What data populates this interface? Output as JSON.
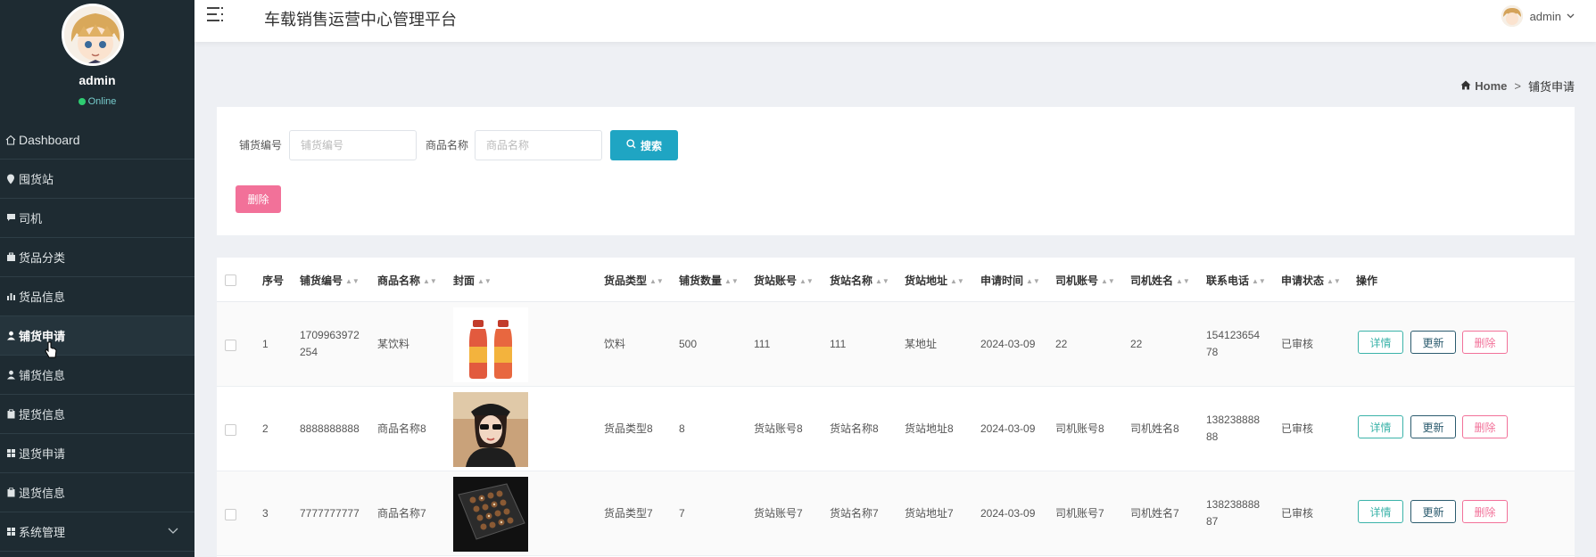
{
  "app": {
    "title": "车载销售运营中心管理平台"
  },
  "user": {
    "name": "admin",
    "status": "Online"
  },
  "top_user": {
    "name": "admin"
  },
  "sidebar": {
    "items": [
      {
        "label": "Dashboard",
        "icon": "home-icon"
      },
      {
        "label": "囤货站",
        "icon": "map-pin-icon"
      },
      {
        "label": "司机",
        "icon": "comment-icon"
      },
      {
        "label": "货品分类",
        "icon": "briefcase-icon"
      },
      {
        "label": "货品信息",
        "icon": "chart-icon"
      },
      {
        "label": "铺货申请",
        "icon": "user-icon",
        "active": true
      },
      {
        "label": "铺货信息",
        "icon": "user-icon"
      },
      {
        "label": "提货信息",
        "icon": "clipboard-icon"
      },
      {
        "label": "退货申请",
        "icon": "grid-icon"
      },
      {
        "label": "退货信息",
        "icon": "clipboard-icon"
      },
      {
        "label": "系统管理",
        "icon": "grid-icon"
      }
    ]
  },
  "breadcrumb": {
    "home": "Home",
    "separator": ">",
    "current": "铺货申请"
  },
  "search": {
    "code_label": "铺货编号",
    "code_placeholder": "铺货编号",
    "name_label": "商品名称",
    "name_placeholder": "商品名称",
    "search_button": "搜索",
    "delete_button": "删除"
  },
  "table": {
    "headers": [
      "序号",
      "铺货编号",
      "商品名称",
      "封面",
      "货品类型",
      "铺货数量",
      "货站账号",
      "货站名称",
      "货站地址",
      "申请时间",
      "司机账号",
      "司机姓名",
      "联系电话",
      "申请状态",
      "操作"
    ],
    "rows": [
      {
        "index": "1",
        "code": "1709963972254",
        "code_l1": "1709963972",
        "code_l2": "254",
        "name": "某饮料",
        "type": "饮料",
        "qty": "500",
        "station_account": "111",
        "station_name": "111",
        "station_addr": "某地址",
        "time": "2024-03-09",
        "driver_account": "22",
        "driver_name": "22",
        "phone_l1": "154123654",
        "phone_l2": "78",
        "status": "已审核"
      },
      {
        "index": "2",
        "code": "8888888888",
        "name": "商品名称8",
        "type": "货品类型8",
        "qty": "8",
        "station_account": "货站账号8",
        "station_name": "货站名称8",
        "station_addr": "货站地址8",
        "time": "2024-03-09",
        "driver_account": "司机账号8",
        "driver_name": "司机姓名8",
        "phone_l1": "138238888",
        "phone_l2": "88",
        "status": "已审核"
      },
      {
        "index": "3",
        "code": "7777777777",
        "name": "商品名称7",
        "type": "货品类型7",
        "qty": "7",
        "station_account": "货站账号7",
        "station_name": "货站名称7",
        "station_addr": "货站地址7",
        "time": "2024-03-09",
        "driver_account": "司机账号7",
        "driver_name": "司机姓名7",
        "phone_l1": "138238888",
        "phone_l2": "87",
        "status": "已审核"
      }
    ],
    "actions": {
      "detail": "详情",
      "update": "更新",
      "delete": "删除"
    }
  }
}
